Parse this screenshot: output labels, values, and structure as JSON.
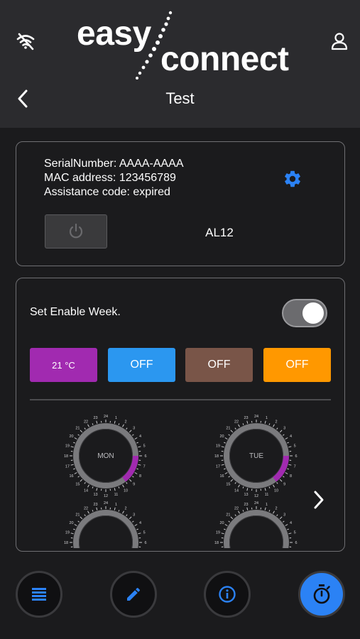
{
  "header": {
    "logo_easy": "easy",
    "logo_connect": "connect",
    "title": "Test",
    "icons": {
      "connection": "wifi-off-icon",
      "user": "user-icon",
      "back": "chevron-left-icon"
    }
  },
  "device": {
    "serial": "SerialNumber: AAAA-AAAA",
    "mac": "MAC address: 123456789",
    "assistance": "Assistance code: expired",
    "name": "AL12",
    "icons": {
      "settings": "gear-icon",
      "power": "power-icon"
    }
  },
  "week": {
    "label": "Set Enable Week.",
    "toggle_on": true,
    "modes": [
      {
        "label": "21 °C",
        "color": "#a12ab0"
      },
      {
        "label": "OFF",
        "color": "#2b97f0"
      },
      {
        "label": "OFF",
        "color": "#795548"
      },
      {
        "label": "OFF",
        "color": "#ff9800"
      }
    ],
    "days": [
      {
        "label": "MON",
        "arc_color": "#a12ab0"
      },
      {
        "label": "TUE",
        "arc_color": "#a12ab0"
      }
    ],
    "next_icon": "chevron-right-icon"
  },
  "bottom_nav": [
    {
      "icon": "list-icon",
      "active": false
    },
    {
      "icon": "pencil-icon",
      "active": false
    },
    {
      "icon": "info-icon",
      "active": false
    },
    {
      "icon": "stopwatch-icon",
      "active": true
    }
  ],
  "colors": {
    "accent": "#2b82f5",
    "gear": "#2b82f5",
    "background": "#1b1b1d",
    "header": "#2b2b2e"
  }
}
